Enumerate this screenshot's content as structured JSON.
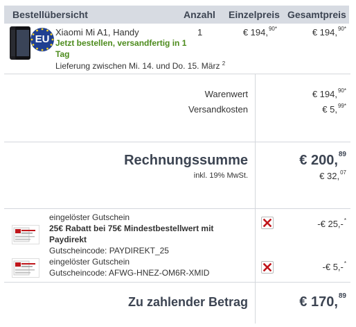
{
  "header": {
    "overview": "Bestellübersicht",
    "quantity": "Anzahl",
    "unit_price": "Einzelpreis",
    "total_price": "Gesamtpreis"
  },
  "product": {
    "name": "Xiaomi Mi A1, Handy",
    "availability_line1": "Jetzt bestellen, versandfertig in 1",
    "availability_line2": "Tag",
    "delivery": "Lieferung zwischen Mi. 14. und Do. 15. März",
    "delivery_note": "2",
    "badge": "EU",
    "quantity": "1",
    "unit_price_main": "€ 194,",
    "unit_price_cents": "90*",
    "total_price_main": "€ 194,",
    "total_price_cents": "90*"
  },
  "summary": {
    "goods_value_label": "Warenwert",
    "goods_value_main": "€ 194,",
    "goods_value_cents": "90*",
    "shipping_label": "Versandkosten",
    "shipping_main": "€ 5,",
    "shipping_cents": "99*",
    "invoice_total_label": "Rechnungssumme",
    "invoice_total_main": "€ 200,",
    "invoice_total_cents": "89",
    "vat_label": "inkl. 19% MwSt.",
    "vat_main": "€ 32,",
    "vat_cents": "07"
  },
  "vouchers": [
    {
      "title": "eingelöster Gutschein",
      "desc_line1": "25€ Rabatt bei 75€ Mindestbestellwert mit",
      "desc_line2": "Paydirekt",
      "code": "Gutscheincode: PAYDIREKT_25",
      "amount_main": "-€ 25,-",
      "amount_mark": "*"
    },
    {
      "title": "eingelöster Gutschein",
      "code": "Gutscheincode: AFWG-HNEZ-OM6R-XMID",
      "amount_main": "-€ 5,-",
      "amount_mark": "*"
    }
  ],
  "payable": {
    "label": "Zu zahlender Betrag",
    "main": "€ 170,",
    "cents": "89"
  },
  "colors": {
    "header_bg": "#d7dbe2",
    "availability_green": "#4c8b1c",
    "remove_red": "#c0161b",
    "eu_blue": "#1f3f91"
  },
  "icons": {
    "remove": "remove-x-icon",
    "voucher": "voucher-card-icon"
  }
}
